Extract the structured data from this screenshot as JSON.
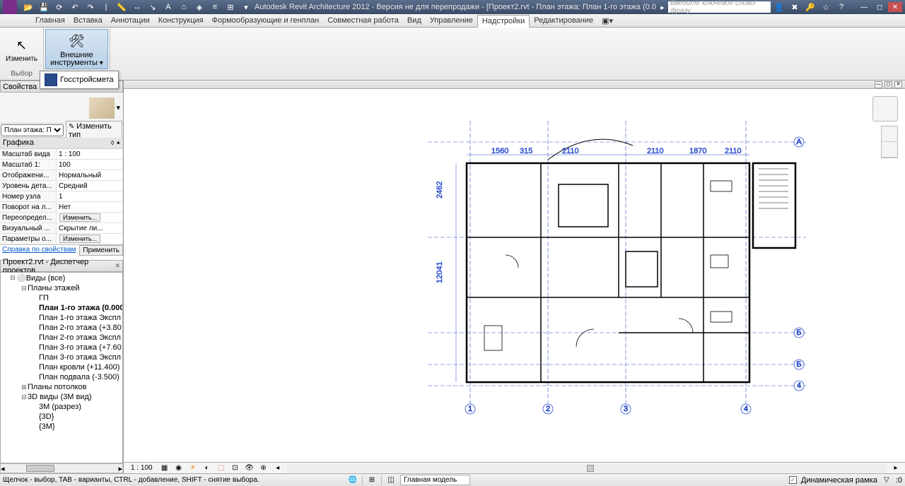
{
  "title": "Autodesk Revit Architecture 2012 - Версия не для перепродажи - [Проект2.rvt - План этажа: План 1-го этажа (0.0...",
  "search_placeholder": "Введите ключевое слово/фразу",
  "ribbon_tabs": [
    "Главная",
    "Вставка",
    "Аннотации",
    "Конструкция",
    "Формообразующие и генплан",
    "Совместная работа",
    "Вид",
    "Управление",
    "Надстройки",
    "Редактирование"
  ],
  "active_tab": 8,
  "ribbon": {
    "modify_label": "Изменить",
    "select_group": "Выбор",
    "external_label1": "Внешние",
    "external_label2": "инструменты",
    "gos_label": "Госстройсмета"
  },
  "props": {
    "panel_title": "Свойства",
    "category": "План этажа: П",
    "edit_type": "Изменить тип",
    "section": "Графика",
    "rows": [
      {
        "n": "Масштаб вида",
        "v": "1 : 100"
      },
      {
        "n": "Масштаб   1:",
        "v": "100"
      },
      {
        "n": "Отображени...",
        "v": "Нормальный"
      },
      {
        "n": "Уровень дета...",
        "v": "Средний"
      },
      {
        "n": "Номер узла",
        "v": "1"
      },
      {
        "n": "Поворот на л...",
        "v": "Нет"
      },
      {
        "n": "Переопредел...",
        "v": "Изменить..."
      },
      {
        "n": "Визуальный ...",
        "v": "Скрытие ли..."
      },
      {
        "n": "Параметры о...",
        "v": "Изменить..."
      }
    ],
    "help_link": "Справка по свойствам",
    "apply": "Применить"
  },
  "browser": {
    "title": "Проект2.rvt - Диспетчер проектов",
    "root": "Виды (все)",
    "floor_plans": "Планы этажей",
    "items": [
      "ГП",
      "План 1-го этажа (0.000",
      "План 1-го этажа Экспл",
      "План 2-го этажа (+3.80",
      "План 2-го этажа Экспл",
      "План 3-го этажа (+7.60",
      "План 3-го этажа Экспл",
      "План кровли (+11.400)",
      "План подвала (-3.500)"
    ],
    "selected": 1,
    "ceiling_plans": "Планы потолков",
    "views3d": "3D виды (3М вид)",
    "v3d_items": [
      "3М (разрез)",
      "{3D}",
      "{3М}"
    ]
  },
  "viewbar": {
    "scale": "1 : 100"
  },
  "status": {
    "hint": "Щелчок - выбор, TAB - варианты, CTRL - добавление, SHIFT - снятие выбора.",
    "model": "Главная модель",
    "dyn_frame": "Динамическая рамка"
  }
}
